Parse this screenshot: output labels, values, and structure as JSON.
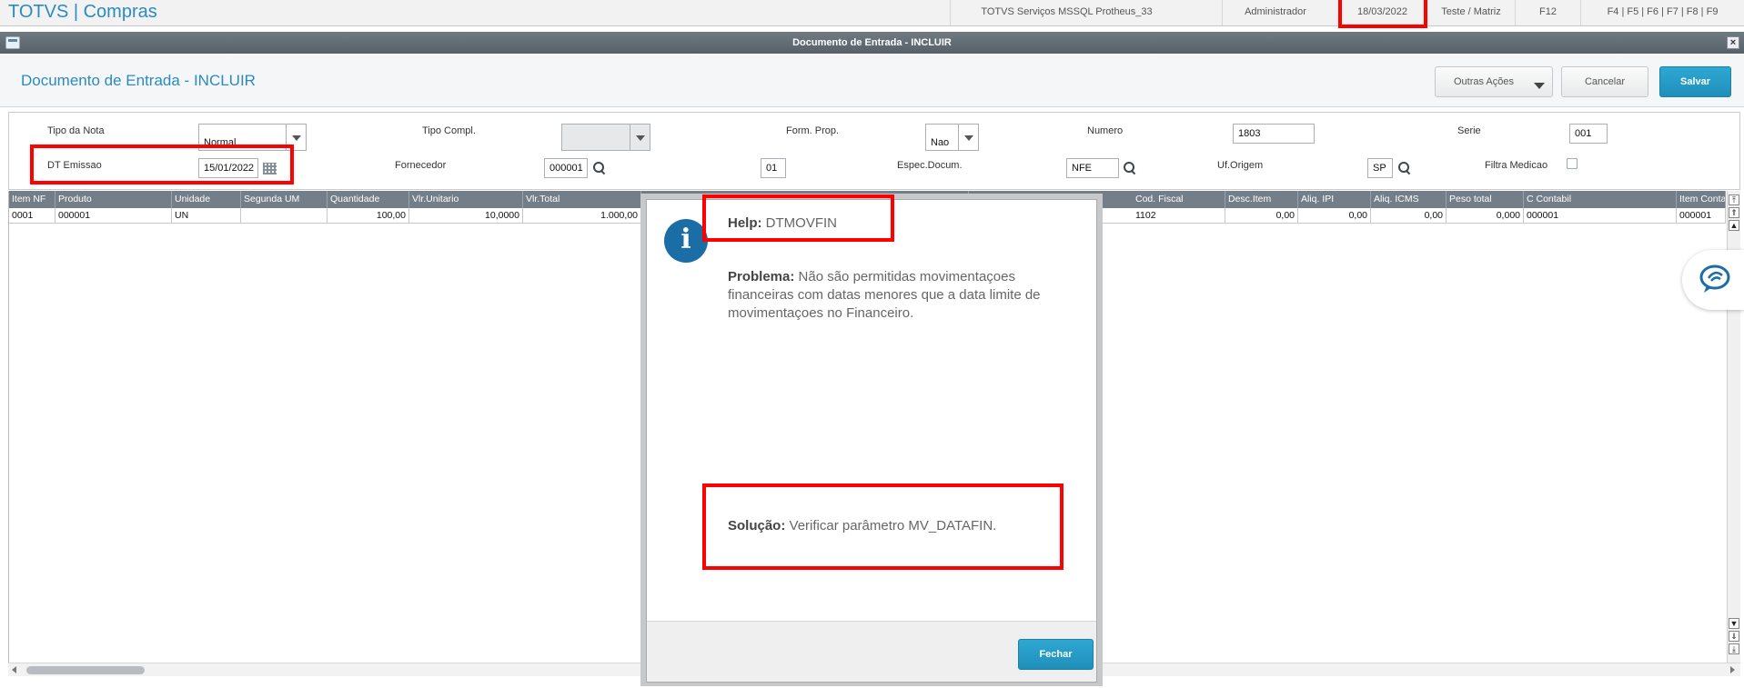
{
  "topbar": {
    "app_title": "TOTVS | Compras",
    "environment": "TOTVS Serviços MSSQL Protheus_33",
    "user": "Administrador",
    "date": "18/03/2022",
    "branch": "Teste / Matriz",
    "f12": "F12",
    "shortcuts": "F4 | F5 | F6 | F7 | F8 | F9"
  },
  "window": {
    "title": "Documento de Entrada - INCLUIR",
    "close_glyph": "×"
  },
  "header": {
    "page_title": "Documento de Entrada - INCLUIR",
    "other_actions_label": "Outras Ações",
    "cancel_label": "Cancelar",
    "save_label": "Salvar"
  },
  "form": {
    "tipo_nota": {
      "label": "Tipo da Nota",
      "value": "Normal"
    },
    "tipo_compl": {
      "label": "Tipo Compl.",
      "value": ""
    },
    "form_prop": {
      "label": "Form. Prop.",
      "value": "Nao"
    },
    "numero": {
      "label": "Numero",
      "value": "1803"
    },
    "serie": {
      "label": "Serie",
      "value": "001"
    },
    "dt_emissao": {
      "label": "DT Emissao",
      "value": "15/01/2022"
    },
    "fornecedor": {
      "label": "Fornecedor",
      "value": "000001",
      "loja": "01"
    },
    "espec_docum": {
      "label": "Espec.Docum.",
      "value": "NFE"
    },
    "uf_origem": {
      "label": "Uf.Origem",
      "value": "SP"
    },
    "filtra_medicao": {
      "label": "Filtra Medicao",
      "checked": false
    }
  },
  "grid": {
    "columns": [
      "Item NF",
      "Produto",
      "Unidade",
      "Segunda UM",
      "Quantidade",
      "Vlr.Unitario",
      "Vlr.Total",
      "Cod. Fiscal",
      "Desc.Item",
      "Aliq. IPI",
      "Aliq. ICMS",
      "Peso total",
      "C Contabil",
      "Item Conta"
    ],
    "row": [
      "0001",
      "000001",
      "UN",
      "",
      "100,00",
      "10,0000",
      "1.000,00",
      "1102",
      "0,00",
      "0,00",
      "0,00",
      "0,000",
      "000001",
      "000001"
    ]
  },
  "help_dialog": {
    "help_label": "Help:",
    "help_code": "DTMOVFIN",
    "problem_label": "Problema:",
    "problem_text": "Não são permitidas movimentaçoes financeiras com datas menores que a data limite de movimentaçoes no Financeiro.",
    "solution_label": "Solução:",
    "solution_text": "Verificar parâmetro MV_DATAFIN.",
    "info_glyph": "i",
    "close_label": "Fechar"
  },
  "icons": {
    "search": "search-icon",
    "calendar": "calendar-icon",
    "chat": "chat-icon",
    "info": "info-icon"
  },
  "colors": {
    "brand_blue": "#2b8bc0",
    "primary_button": "#2ea8d3",
    "grid_header": "#737e88",
    "highlight": "#ff0000",
    "info_icon": "#1b6ea5"
  }
}
